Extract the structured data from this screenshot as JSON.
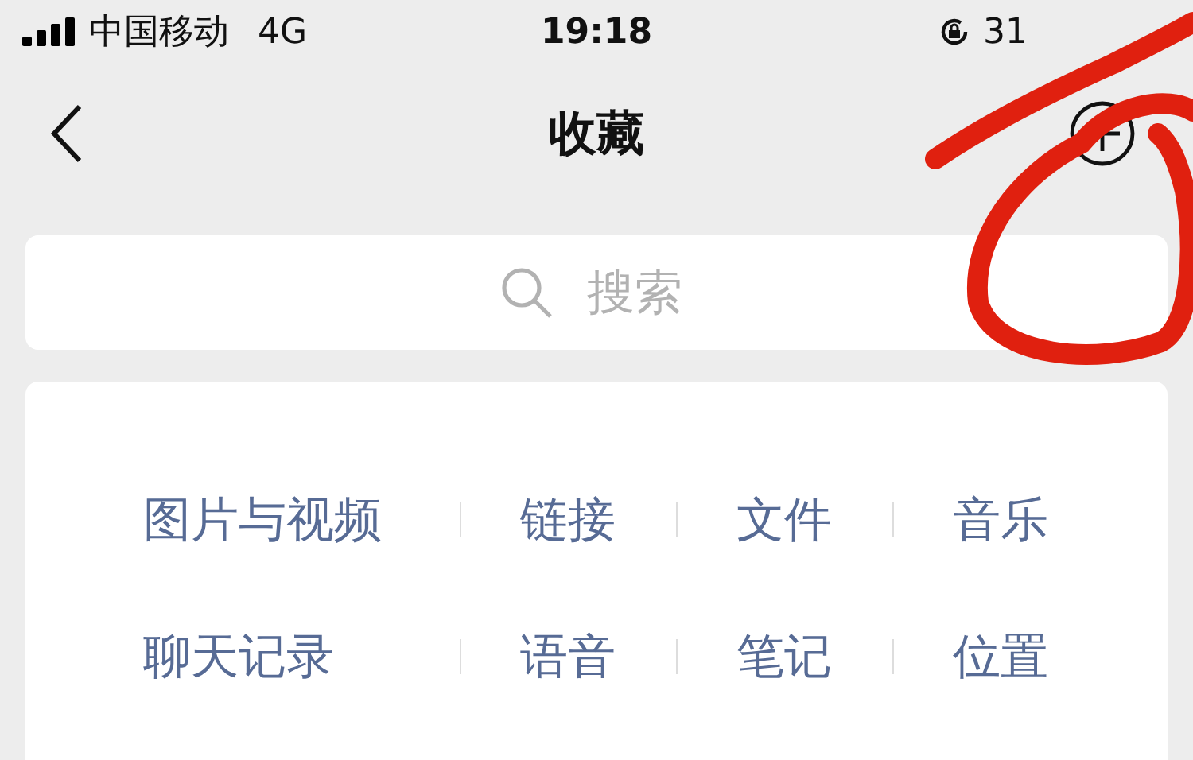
{
  "status_bar": {
    "carrier": "中国移动",
    "network": "4G",
    "time": "19:18",
    "battery_percent": "31"
  },
  "nav": {
    "title": "收藏"
  },
  "search": {
    "placeholder": "搜索"
  },
  "categories": [
    {
      "label": "图片与视频"
    },
    {
      "label": "链接"
    },
    {
      "label": "文件"
    },
    {
      "label": "音乐"
    },
    {
      "label": "聊天记录"
    },
    {
      "label": "语音"
    },
    {
      "label": "笔记"
    },
    {
      "label": "位置"
    }
  ]
}
